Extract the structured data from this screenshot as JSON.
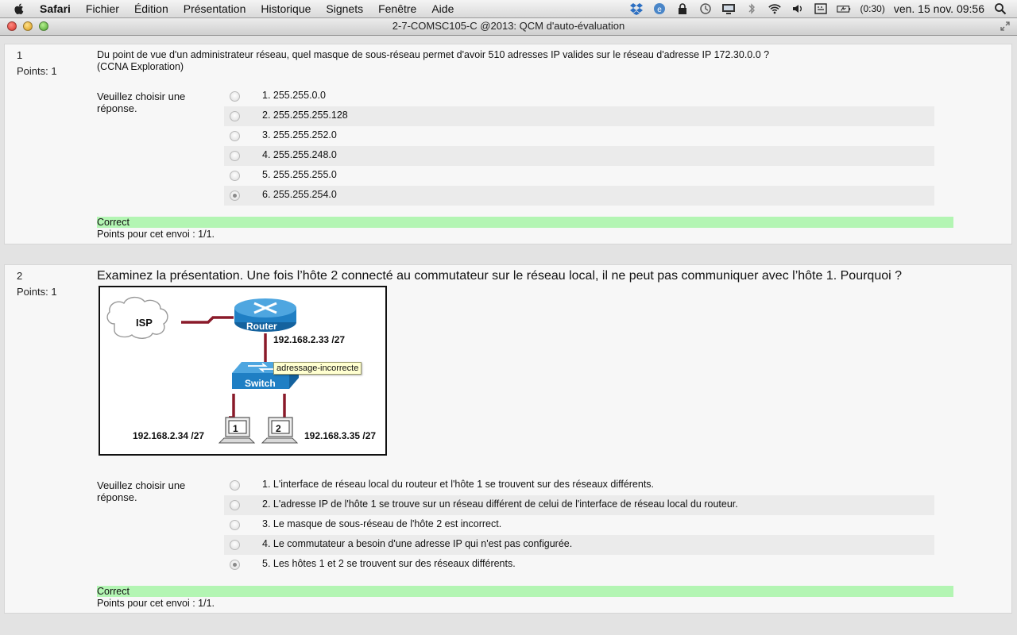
{
  "menubar": {
    "app": "Safari",
    "items": [
      "Fichier",
      "Édition",
      "Présentation",
      "Historique",
      "Signets",
      "Fenêtre",
      "Aide"
    ],
    "battery": "(0:30)",
    "clock": "ven. 15 nov.  09:56"
  },
  "window": {
    "title": "2-7-COMSC105-C @2013: QCM d'auto-évaluation"
  },
  "questions": [
    {
      "number": "1",
      "points": "Points: 1",
      "text_line1": "Du point de vue d'un administrateur réseau, quel masque de sous-réseau permet d'avoir 510 adresses IP valides sur le réseau d'adresse IP 172.30.0.0 ?",
      "text_line2": "(CCNA Exploration)",
      "prompt": "Veuillez choisir une réponse.",
      "answers": [
        {
          "label": "1. 255.255.0.0",
          "selected": false
        },
        {
          "label": "2. 255.255.255.128",
          "selected": false
        },
        {
          "label": "3. 255.255.252.0",
          "selected": false
        },
        {
          "label": "4. 255.255.248.0",
          "selected": false
        },
        {
          "label": "5. 255.255.255.0",
          "selected": false
        },
        {
          "label": "6. 255.255.254.0",
          "selected": true
        }
      ],
      "feedback": "Correct",
      "score": "Points pour cet envoi : 1/1."
    },
    {
      "number": "2",
      "points": "Points: 1",
      "text": "Examinez la présentation. Une fois l’hôte 2 connecté au commutateur sur le réseau local, il ne peut pas communiquer avec l’hôte 1. Pourquoi ?",
      "diagram": {
        "isp": "ISP",
        "router": "Router",
        "router_ip": "192.168.2.33 /27",
        "switch": "Switch",
        "tooltip": "adressage-incorrecte",
        "host1_label": "1",
        "host2_label": "2",
        "host1_ip": "192.168.2.34 /27",
        "host2_ip": "192.168.3.35 /27"
      },
      "prompt": "Veuillez choisir une réponse.",
      "answers": [
        {
          "label": "1. L'interface de réseau local du routeur et l'hôte 1 se trouvent sur des réseaux différents.",
          "selected": false
        },
        {
          "label": "2. L'adresse IP de l'hôte 1 se trouve sur un réseau différent de celui de l'interface de réseau local du routeur.",
          "selected": false
        },
        {
          "label": "3. Le masque de sous-réseau de l'hôte 2 est incorrect.",
          "selected": false
        },
        {
          "label": "4. Le commutateur a besoin d'une adresse IP qui n'est pas configurée.",
          "selected": false
        },
        {
          "label": "5. Les hôtes 1 et 2 se trouvent sur des réseaux différents.",
          "selected": true
        }
      ],
      "feedback": "Correct",
      "score": "Points pour cet envoi : 1/1."
    }
  ],
  "colors": {
    "feedback_bg": "#b3f5b3",
    "link_red": "#8a1a2a",
    "device_blue": "#1f7fc4"
  }
}
